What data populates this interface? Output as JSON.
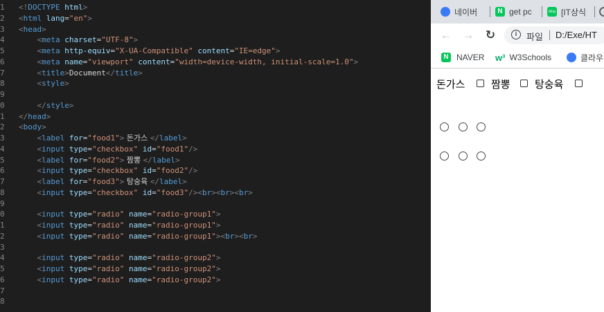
{
  "editor": {
    "lines": [
      {
        "n": "1",
        "tokens": [
          [
            "punct",
            "<!"
          ],
          [
            "tag",
            "DOCTYPE"
          ],
          [
            "text",
            " "
          ],
          [
            "attr",
            "html"
          ],
          [
            "punct",
            ">"
          ]
        ]
      },
      {
        "n": "2",
        "tokens": [
          [
            "punct",
            "<"
          ],
          [
            "tag",
            "html"
          ],
          [
            "text",
            " "
          ],
          [
            "attr",
            "lang"
          ],
          [
            "text",
            "="
          ],
          [
            "str",
            "\"en\""
          ],
          [
            "punct",
            ">"
          ]
        ]
      },
      {
        "n": "3",
        "tokens": [
          [
            "punct",
            "<"
          ],
          [
            "tag",
            "head"
          ],
          [
            "punct",
            ">"
          ]
        ]
      },
      {
        "n": "4",
        "tokens": [
          [
            "text",
            "    "
          ],
          [
            "punct",
            "<"
          ],
          [
            "tag",
            "meta"
          ],
          [
            "text",
            " "
          ],
          [
            "attr",
            "charset"
          ],
          [
            "text",
            "="
          ],
          [
            "str",
            "\"UTF-8\""
          ],
          [
            "punct",
            ">"
          ]
        ]
      },
      {
        "n": "5",
        "tokens": [
          [
            "text",
            "    "
          ],
          [
            "punct",
            "<"
          ],
          [
            "tag",
            "meta"
          ],
          [
            "text",
            " "
          ],
          [
            "attr",
            "http-equiv"
          ],
          [
            "text",
            "="
          ],
          [
            "str",
            "\"X-UA-Compatible\""
          ],
          [
            "text",
            " "
          ],
          [
            "attr",
            "content"
          ],
          [
            "text",
            "="
          ],
          [
            "str",
            "\"IE=edge\""
          ],
          [
            "punct",
            ">"
          ]
        ]
      },
      {
        "n": "6",
        "tokens": [
          [
            "text",
            "    "
          ],
          [
            "punct",
            "<"
          ],
          [
            "tag",
            "meta"
          ],
          [
            "text",
            " "
          ],
          [
            "attr",
            "name"
          ],
          [
            "text",
            "="
          ],
          [
            "str",
            "\"viewport\""
          ],
          [
            "text",
            " "
          ],
          [
            "attr",
            "content"
          ],
          [
            "text",
            "="
          ],
          [
            "str",
            "\"width=device-width, initial-scale=1.0\""
          ],
          [
            "punct",
            ">"
          ]
        ]
      },
      {
        "n": "7",
        "tokens": [
          [
            "text",
            "    "
          ],
          [
            "punct",
            "<"
          ],
          [
            "tag",
            "title"
          ],
          [
            "punct",
            ">"
          ],
          [
            "text",
            "Document"
          ],
          [
            "punct",
            "</"
          ],
          [
            "tag",
            "title"
          ],
          [
            "punct",
            ">"
          ]
        ]
      },
      {
        "n": "8",
        "tokens": [
          [
            "text",
            "    "
          ],
          [
            "punct",
            "<"
          ],
          [
            "tag",
            "style"
          ],
          [
            "punct",
            ">"
          ]
        ]
      },
      {
        "n": "9",
        "tokens": []
      },
      {
        "n": "0",
        "tokens": [
          [
            "text",
            "    "
          ],
          [
            "punct",
            "</"
          ],
          [
            "tag",
            "style"
          ],
          [
            "punct",
            ">"
          ]
        ]
      },
      {
        "n": "1",
        "tokens": [
          [
            "punct",
            "</"
          ],
          [
            "tag",
            "head"
          ],
          [
            "punct",
            ">"
          ]
        ]
      },
      {
        "n": "2",
        "tokens": [
          [
            "punct",
            "<"
          ],
          [
            "tag",
            "body"
          ],
          [
            "punct",
            ">"
          ]
        ]
      },
      {
        "n": "3",
        "tokens": [
          [
            "text",
            "    "
          ],
          [
            "punct",
            "<"
          ],
          [
            "tag",
            "label"
          ],
          [
            "text",
            " "
          ],
          [
            "attr",
            "for"
          ],
          [
            "text",
            "="
          ],
          [
            "str",
            "\"food1\""
          ],
          [
            "punct",
            ">"
          ],
          [
            "kor",
            " 돈가스 "
          ],
          [
            "punct",
            "</"
          ],
          [
            "tag",
            "label"
          ],
          [
            "punct",
            ">"
          ]
        ]
      },
      {
        "n": "4",
        "tokens": [
          [
            "text",
            "    "
          ],
          [
            "punct",
            "<"
          ],
          [
            "tag",
            "input"
          ],
          [
            "text",
            " "
          ],
          [
            "attr",
            "type"
          ],
          [
            "text",
            "="
          ],
          [
            "str",
            "\"checkbox\""
          ],
          [
            "text",
            " "
          ],
          [
            "attr",
            "id"
          ],
          [
            "text",
            "="
          ],
          [
            "str",
            "\"food1\""
          ],
          [
            "punct",
            "/>"
          ]
        ]
      },
      {
        "n": "5",
        "tokens": [
          [
            "text",
            "    "
          ],
          [
            "punct",
            "<"
          ],
          [
            "tag",
            "label"
          ],
          [
            "text",
            " "
          ],
          [
            "attr",
            "for"
          ],
          [
            "text",
            "="
          ],
          [
            "str",
            "\"food2\""
          ],
          [
            "punct",
            ">"
          ],
          [
            "kor",
            " 짬뽕 "
          ],
          [
            "punct",
            "</"
          ],
          [
            "tag",
            "label"
          ],
          [
            "punct",
            ">"
          ]
        ]
      },
      {
        "n": "6",
        "tokens": [
          [
            "text",
            "    "
          ],
          [
            "punct",
            "<"
          ],
          [
            "tag",
            "input"
          ],
          [
            "text",
            " "
          ],
          [
            "attr",
            "type"
          ],
          [
            "text",
            "="
          ],
          [
            "str",
            "\"checkbox\""
          ],
          [
            "text",
            " "
          ],
          [
            "attr",
            "id"
          ],
          [
            "text",
            "="
          ],
          [
            "str",
            "\"food2\""
          ],
          [
            "punct",
            "/>"
          ]
        ]
      },
      {
        "n": "7",
        "tokens": [
          [
            "text",
            "    "
          ],
          [
            "punct",
            "<"
          ],
          [
            "tag",
            "label"
          ],
          [
            "text",
            " "
          ],
          [
            "attr",
            "for"
          ],
          [
            "text",
            "="
          ],
          [
            "str",
            "\"food3\""
          ],
          [
            "punct",
            ">"
          ],
          [
            "kor",
            " 탕숭육 "
          ],
          [
            "punct",
            "</"
          ],
          [
            "tag",
            "label"
          ],
          [
            "punct",
            ">"
          ]
        ]
      },
      {
        "n": "8",
        "tokens": [
          [
            "text",
            "    "
          ],
          [
            "punct",
            "<"
          ],
          [
            "tag",
            "input"
          ],
          [
            "text",
            " "
          ],
          [
            "attr",
            "type"
          ],
          [
            "text",
            "="
          ],
          [
            "str",
            "\"checkbox\""
          ],
          [
            "text",
            " "
          ],
          [
            "attr",
            "id"
          ],
          [
            "text",
            "="
          ],
          [
            "str",
            "\"food3\""
          ],
          [
            "punct",
            "/><"
          ],
          [
            "tag",
            "br"
          ],
          [
            "punct",
            "><"
          ],
          [
            "tag",
            "br"
          ],
          [
            "punct",
            "><"
          ],
          [
            "tag",
            "br"
          ],
          [
            "punct",
            ">"
          ]
        ]
      },
      {
        "n": "9",
        "tokens": []
      },
      {
        "n": "0",
        "tokens": [
          [
            "text",
            "    "
          ],
          [
            "punct",
            "<"
          ],
          [
            "tag",
            "input"
          ],
          [
            "text",
            " "
          ],
          [
            "attr",
            "type"
          ],
          [
            "text",
            "="
          ],
          [
            "str",
            "\"radio\""
          ],
          [
            "text",
            " "
          ],
          [
            "attr",
            "name"
          ],
          [
            "text",
            "="
          ],
          [
            "str",
            "\"radio-group1\""
          ],
          [
            "punct",
            ">"
          ]
        ]
      },
      {
        "n": "1",
        "tokens": [
          [
            "text",
            "    "
          ],
          [
            "punct",
            "<"
          ],
          [
            "tag",
            "input"
          ],
          [
            "text",
            " "
          ],
          [
            "attr",
            "type"
          ],
          [
            "text",
            "="
          ],
          [
            "str",
            "\"radio\""
          ],
          [
            "text",
            " "
          ],
          [
            "attr",
            "name"
          ],
          [
            "text",
            "="
          ],
          [
            "str",
            "\"radio-group1\""
          ],
          [
            "punct",
            ">"
          ]
        ]
      },
      {
        "n": "2",
        "tokens": [
          [
            "text",
            "    "
          ],
          [
            "punct",
            "<"
          ],
          [
            "tag",
            "input"
          ],
          [
            "text",
            " "
          ],
          [
            "attr",
            "type"
          ],
          [
            "text",
            "="
          ],
          [
            "str",
            "\"radio\""
          ],
          [
            "text",
            " "
          ],
          [
            "attr",
            "name"
          ],
          [
            "text",
            "="
          ],
          [
            "str",
            "\"radio-group1\""
          ],
          [
            "punct",
            "><"
          ],
          [
            "tag",
            "br"
          ],
          [
            "punct",
            "><"
          ],
          [
            "tag",
            "br"
          ],
          [
            "punct",
            ">"
          ]
        ]
      },
      {
        "n": "3",
        "tokens": []
      },
      {
        "n": "4",
        "tokens": [
          [
            "text",
            "    "
          ],
          [
            "punct",
            "<"
          ],
          [
            "tag",
            "input"
          ],
          [
            "text",
            " "
          ],
          [
            "attr",
            "type"
          ],
          [
            "text",
            "="
          ],
          [
            "str",
            "\"radio\""
          ],
          [
            "text",
            " "
          ],
          [
            "attr",
            "name"
          ],
          [
            "text",
            "="
          ],
          [
            "str",
            "\"radio-group2\""
          ],
          [
            "punct",
            ">"
          ]
        ]
      },
      {
        "n": "5",
        "tokens": [
          [
            "text",
            "    "
          ],
          [
            "punct",
            "<"
          ],
          [
            "tag",
            "input"
          ],
          [
            "text",
            " "
          ],
          [
            "attr",
            "type"
          ],
          [
            "text",
            "="
          ],
          [
            "str",
            "\"radio\""
          ],
          [
            "text",
            " "
          ],
          [
            "attr",
            "name"
          ],
          [
            "text",
            "="
          ],
          [
            "str",
            "\"radio-group2\""
          ],
          [
            "punct",
            ">"
          ]
        ]
      },
      {
        "n": "6",
        "tokens": [
          [
            "text",
            "    "
          ],
          [
            "punct",
            "<"
          ],
          [
            "tag",
            "input"
          ],
          [
            "text",
            " "
          ],
          [
            "attr",
            "type"
          ],
          [
            "text",
            "="
          ],
          [
            "str",
            "\"radio\""
          ],
          [
            "text",
            " "
          ],
          [
            "attr",
            "name"
          ],
          [
            "text",
            "="
          ],
          [
            "str",
            "\"radio-group2\""
          ],
          [
            "punct",
            ">"
          ]
        ]
      },
      {
        "n": "7",
        "tokens": []
      },
      {
        "n": "8",
        "tokens": []
      }
    ]
  },
  "browser": {
    "tabs": [
      {
        "label": "네이버",
        "icon": "naver-whale-icon"
      },
      {
        "label": "get pc",
        "icon": "naver-n-icon"
      },
      {
        "label": "[IT상식",
        "icon": "blog-icon"
      }
    ],
    "address": {
      "info_label": "파일",
      "url": "D:/Exe/HT"
    },
    "bookmarks": [
      {
        "label": "NAVER",
        "icon": "naver-n-icon"
      },
      {
        "label": "W3Schools",
        "icon": "w3schools-icon"
      },
      {
        "label": "클라우",
        "icon": "cloud-icon"
      }
    ]
  },
  "page": {
    "labels": [
      "돈가스",
      "짬뽕",
      "탕숭육"
    ]
  },
  "colors": {
    "editor_bg": "#1e1e1e",
    "tag": "#569cd6",
    "attr": "#9cdcfe",
    "string": "#ce9178",
    "punct": "#808080",
    "text": "#d4d4d4",
    "naver_green": "#03c75a",
    "whale_blue": "#3a7bf5"
  }
}
